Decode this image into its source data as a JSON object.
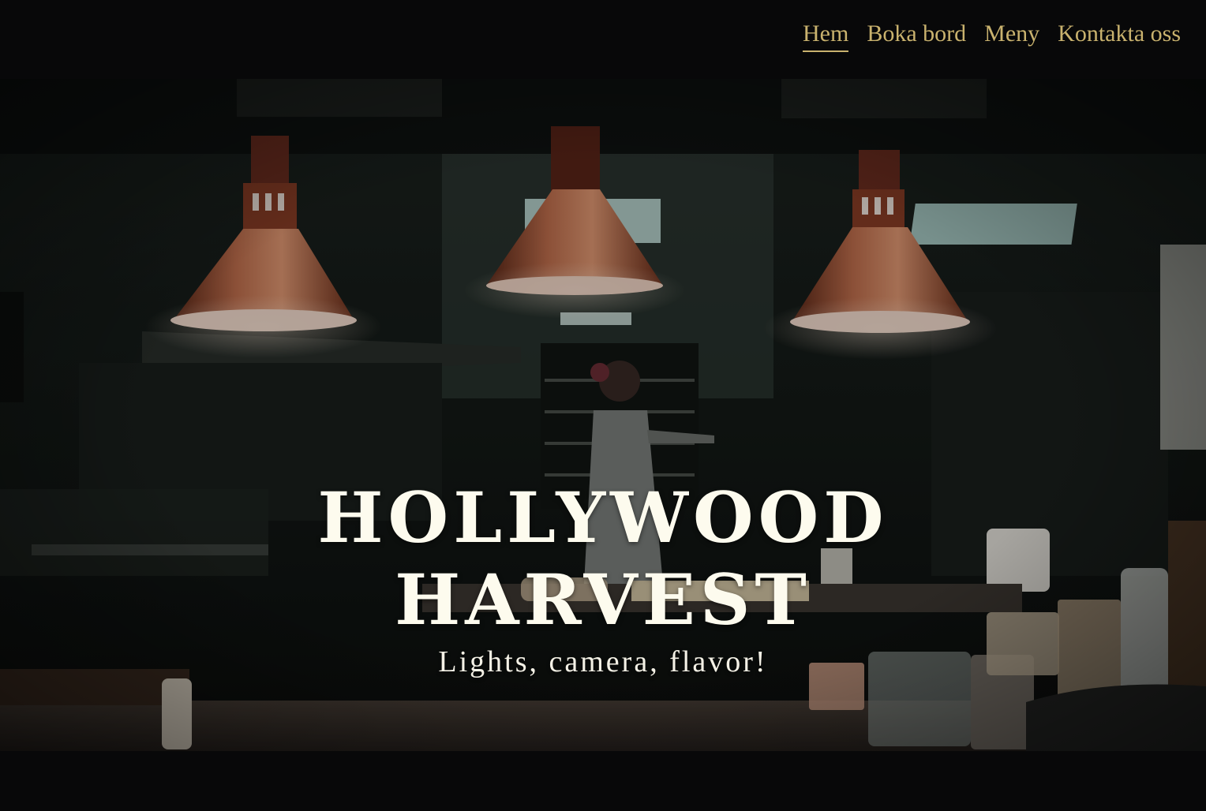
{
  "nav": {
    "items": [
      {
        "label": "Hem",
        "active": true
      },
      {
        "label": "Boka bord",
        "active": false
      },
      {
        "label": "Meny",
        "active": false
      },
      {
        "label": "Kontakta oss",
        "active": false
      }
    ]
  },
  "hero": {
    "title_line1": "HOLLYWOOD",
    "title_line2": "HARVEST",
    "tagline": "Lights, camera, flavor!"
  },
  "colors": {
    "background": "#080809",
    "nav_link": "#c9b26e",
    "title": "#fdfbee",
    "lamp_copper": "#b8664a"
  }
}
